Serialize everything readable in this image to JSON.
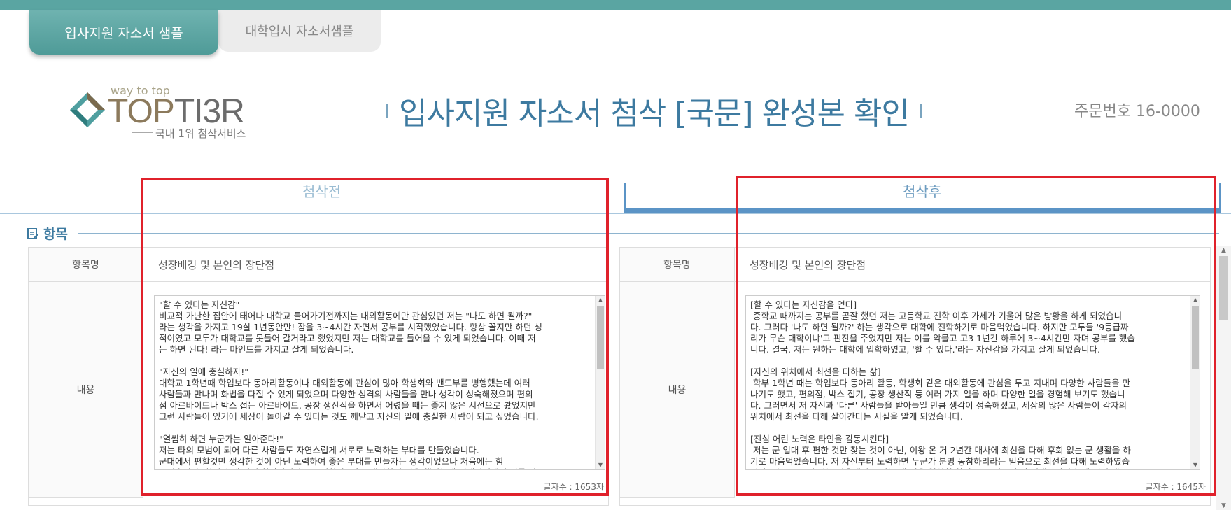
{
  "tabs": [
    {
      "label": "입사지원 자소서 샘플"
    },
    {
      "label": "대학입시 자소서샘플"
    }
  ],
  "logo": {
    "tagline": "way to top",
    "word_top": "TOP",
    "word_tier": "TI3R",
    "subtitle": "국내 1위 첨삭서비스"
  },
  "page": {
    "title": "입사지원 자소서 첨삭 [국문] 완성본 확인",
    "order_number": "주문번호 16-0000"
  },
  "columns": {
    "before_label": "첨삭전",
    "after_label": "첨삭후"
  },
  "section": {
    "label": "항목"
  },
  "before": {
    "item_head": "항목명",
    "item_value": "성장배경 및 본인의 장단점",
    "content_head": "내용",
    "content_text": "\"할 수 있다는 자신감\"\n비교적 가난한 집안에 태어나 대학교 들어가기전까지는 대외활동에만 관심있던 저는 \"나도 하면 될까?\"\n라는 생각을 가지고 19살 1년동안만! 잠을 3~4시간 자면서 공부를 시작했었습니다. 항상 꼴지만 하던 성\n적이였고 모두가 대학교를 못들어 갈거라고 했었지만 저는 대학교를 들어을 수 있게 되었습니다. 이때 저\n는 하면 된다! 라는 마인드를 가지고 살게 되었습니다.\n\n\"자신의 일에 충실하자!\"\n대학교 1학년때 학업보다 동아리활동이나 대외활동에 관심이 많아 학생회와 밴드부를 병행했는데 여러\n사람들과 만나며 화법을 다질 수 있게 되었으며 다양한 성격의 사람들을 만나 생각이 성숙해졌으며 편의\n점 아르바이트나 박스 접는 아르바이트, 공장 생산직을 하면서 어렸을 때는 좋지 않은 시선으로 봤었지만\n그런 사람들이 있기에 세상이 돌아갈 수 있다는 것도 깨닫고 자신의 일에 충실한 사람이 되고 싶었습니다.\n\n\"열씸히 하면 누군가는 알아준다!\"\n저는 타의 모범이 되어 다른 사람들도 자연스럽게 서로로 노력하는 부대를 만들었습니다.\n군대에서 편할것만 생각한 것이 아닌 노력하여 좋은 부대를 만들자는 생각이었으나 처음에는 힘\n들었습니다. 하지만 제 자신 한사람이라도 노력하자! 라고 생각하며 일을 했었는데 연대장님께서 저를 발",
    "char_count": "글자수 : 1653자"
  },
  "after": {
    "item_head": "항목명",
    "item_value": "성장배경 및 본인의 장단점",
    "content_head": "내용",
    "content_text": "[할 수 있다는 자신감을 얻다]\n 중학교 때까지는 공부를 곧잘 했던 저는 고등학교 진학 이후 가세가 기울어 많은 방황을 하게 되었습니\n다. 그러다 '나도 하면 될까?' 하는 생각으로 대학에 진학하기로 마음먹었습니다. 하지만 모두들 '9등급짜\n리가 무슨 대학이냐'고 핀잔을 주었지만 저는 이를 악물고 고3 1년간 하루에 3~4시간만 자며 공부를 했습\n니다. 결국, 저는 원하는 대학에 입학하였고, '할 수 있다.'라는 자신감을 가지고 살게 되었습니다.\n\n[자신의 위치에서 최선을 다하는 삶]\n 학부 1학년 때는 학업보다 동아리 활동, 학생회 같은 대외활동에 관심을 두고 지내며 다양한 사람들을 만\n나기도 했고, 편의점, 박스 접기, 공장 생산직 등 여러 가지 일을 하며 다양한 일을 경험해 보기도 했습니\n다. 그러면서 저 자신과 '다른' 사람들을 받아들일 만큼 생각이 성숙해졌고, 세상의 많은 사람들이 각자의\n위치에서 최선을 다해 살아간다는 사실을 알게 되었습니다.\n\n[진심 어린 노력은 타인을 감동시킨다]\n 저는 군 입대 후 편한 것만 찾는 것이 아닌, 이왕 온 거 2년간 매사에 최선을 다해 후회 없는 군 생활을 하\n기로 마음먹었습니다. 저 자신부터 노력하면 누군가 분명 동참하리라는 믿음으로 최선을 다해 노력하였습\n니다. 아무도 보지 않는 가운데서도 저는 제 일을 열심히 하였고, 그런 모습이 연대장님의 눈에 띄며 제 노",
    "char_count": "글자수 : 1645자"
  },
  "colors": {
    "topbar": "#5aa5a2",
    "title": "#3d7aa0",
    "highlight": "#e0212b",
    "after_tab": "#5b94c6"
  }
}
